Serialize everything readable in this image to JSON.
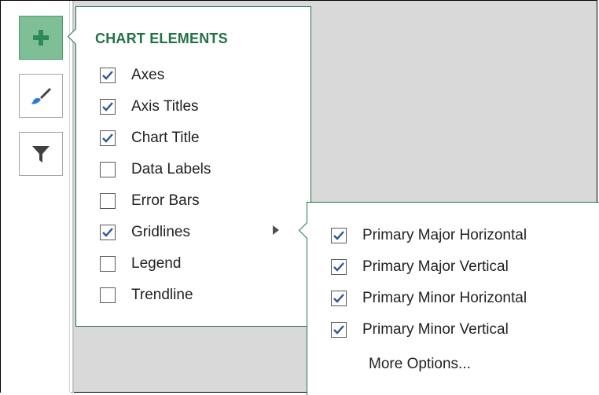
{
  "panel": {
    "title": "CHART ELEMENTS",
    "items": [
      {
        "label": "Axes",
        "checked": true
      },
      {
        "label": "Axis Titles",
        "checked": true
      },
      {
        "label": "Chart Title",
        "checked": true
      },
      {
        "label": "Data Labels",
        "checked": false
      },
      {
        "label": "Error Bars",
        "checked": false
      },
      {
        "label": "Gridlines",
        "checked": true,
        "has_submenu": true
      },
      {
        "label": "Legend",
        "checked": false
      },
      {
        "label": "Trendline",
        "checked": false
      }
    ]
  },
  "submenu": {
    "items": [
      {
        "label": "Primary Major Horizontal",
        "checked": true
      },
      {
        "label": "Primary Major Vertical",
        "checked": true
      },
      {
        "label": "Primary Minor Horizontal",
        "checked": true
      },
      {
        "label": "Primary Minor Vertical",
        "checked": true
      }
    ],
    "more_options": "More Options..."
  },
  "side_buttons": [
    {
      "icon": "plus-icon",
      "active": true
    },
    {
      "icon": "paintbrush-icon",
      "active": false
    },
    {
      "icon": "filter-icon",
      "active": false
    }
  ],
  "colors": {
    "accent": "#217346",
    "active_button": "#7fbf98",
    "check": "#2b579a",
    "canvas": "#d9d9d9"
  }
}
